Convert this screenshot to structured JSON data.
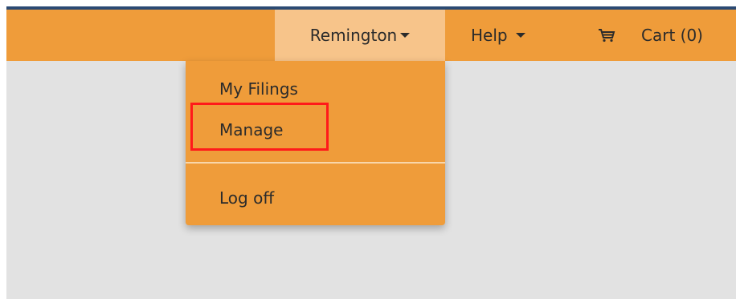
{
  "navbar": {
    "user_menu_label": "Remington",
    "help_label": "Help",
    "cart_label": "Cart (0)"
  },
  "user_menu": {
    "items": [
      {
        "label": "My Filings"
      },
      {
        "label": "Manage"
      },
      {
        "label": "Log off"
      }
    ],
    "highlighted_item": "Manage"
  },
  "colors": {
    "navbar": "#ef9c3a",
    "active_nav": "#f7c48a",
    "top_border": "#2b4a73",
    "page_background": "#e2e2e2",
    "highlight_box": "#ff1a1a"
  },
  "icons": {
    "cart": "cart-icon",
    "caret": "caret-down-icon"
  }
}
